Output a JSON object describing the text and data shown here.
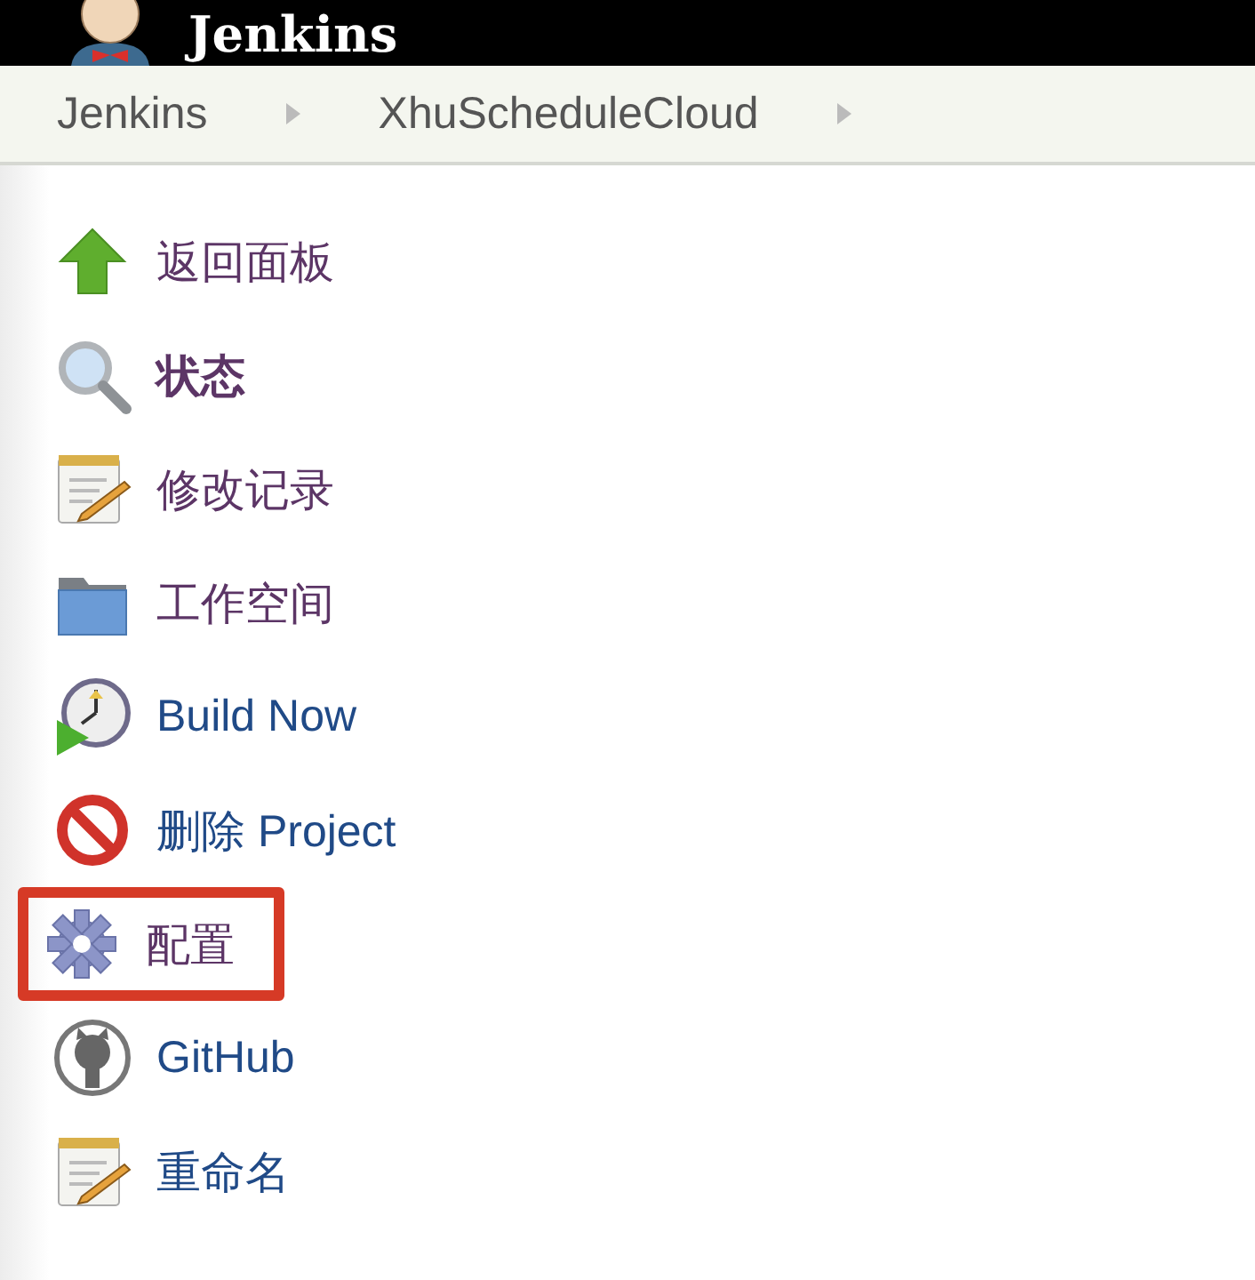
{
  "header": {
    "title": "Jenkins"
  },
  "breadcrumbs": [
    {
      "label": "Jenkins"
    },
    {
      "label": "XhuScheduleCloud"
    }
  ],
  "tasks": [
    {
      "kind": "up-arrow",
      "label": "返回面板",
      "visited": true,
      "selected": false,
      "highlighted": false
    },
    {
      "kind": "magnifier",
      "label": "状态",
      "visited": true,
      "selected": true,
      "highlighted": false
    },
    {
      "kind": "notepad",
      "label": "修改记录",
      "visited": true,
      "selected": false,
      "highlighted": false
    },
    {
      "kind": "folder",
      "label": "工作空间",
      "visited": true,
      "selected": false,
      "highlighted": false
    },
    {
      "kind": "clock",
      "label": "Build Now",
      "visited": false,
      "selected": false,
      "highlighted": false
    },
    {
      "kind": "no-entry",
      "label": "删除 Project",
      "visited": false,
      "selected": false,
      "highlighted": false
    },
    {
      "kind": "gear",
      "label": "配置",
      "visited": true,
      "selected": false,
      "highlighted": true
    },
    {
      "kind": "github",
      "label": "GitHub",
      "visited": false,
      "selected": false,
      "highlighted": false
    },
    {
      "kind": "notepad",
      "label": "重命名",
      "visited": false,
      "selected": false,
      "highlighted": false
    }
  ]
}
